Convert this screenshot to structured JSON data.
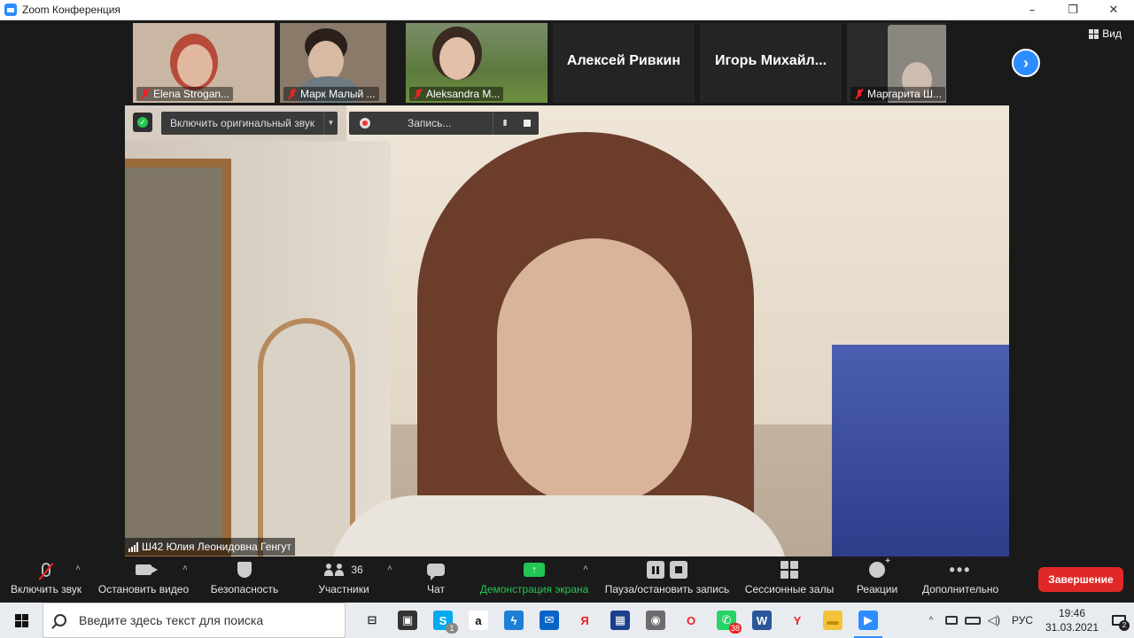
{
  "window": {
    "title": "Zoom Конференция",
    "minimize": "–",
    "maximize": "❐",
    "close": "✕"
  },
  "strip": {
    "thumbs": [
      {
        "name": "Elena Strogan..."
      },
      {
        "name": "Марк Малый ..."
      },
      {
        "name": "Aleksandra M..."
      },
      {
        "name": "",
        "big_name": "Алексей Ривкин"
      },
      {
        "name": "",
        "big_name": "Игорь  Михайл..."
      },
      {
        "name": "Маргарита Ш..."
      }
    ],
    "next": "›"
  },
  "view": {
    "label": "Вид"
  },
  "video_controls": {
    "original_audio": "Включить оригинальный звук",
    "recording": "Запись...",
    "pause_glyph": "II"
  },
  "speaker": {
    "name": "Ш42 Юлия Леонидовна Генгут"
  },
  "toolbar": {
    "unmute": "Включить звук",
    "stop_video": "Остановить видео",
    "security": "Безопасность",
    "participants": "Участники",
    "participants_count": "36",
    "chat": "Чат",
    "share": "Демонстрация экрана",
    "pause_record": "Пауза/остановить запись",
    "rooms": "Сессионные залы",
    "reactions": "Реакции",
    "more": "Дополнительно",
    "end": "Завершение",
    "caret": "˄",
    "share_glyph": "↑",
    "more_glyph": "•••"
  },
  "taskbar": {
    "search_placeholder": "Введите здесь текст для поиска",
    "apps": [
      {
        "icon": "task-view-icon",
        "letter": "⊟",
        "color": "#e8ecf1",
        "fg": "#222"
      },
      {
        "icon": "store-icon",
        "letter": "▣",
        "color": "#333333",
        "fg": "#fff"
      },
      {
        "icon": "skype-icon",
        "letter": "S",
        "color": "#00a9f0",
        "fg": "#fff",
        "badge": "1",
        "badge_gray": true
      },
      {
        "icon": "amazon-icon",
        "letter": "a",
        "color": "#ffffff",
        "fg": "#111"
      },
      {
        "icon": "bolt-icon",
        "letter": "ϟ",
        "color": "#1e7fd6",
        "fg": "#fff"
      },
      {
        "icon": "mail-icon",
        "letter": "✉",
        "color": "#0a64c8",
        "fg": "#fff"
      },
      {
        "icon": "yandex-icon",
        "letter": "Я",
        "color": "#e8ecf1",
        "fg": "#e22"
      },
      {
        "icon": "video-editor-icon",
        "letter": "▦",
        "color": "#1c3f8c",
        "fg": "#fff"
      },
      {
        "icon": "camera-icon",
        "letter": "◉",
        "color": "#6d6d6d",
        "fg": "#fff"
      },
      {
        "icon": "opera-icon",
        "letter": "O",
        "color": "#e8ecf1",
        "fg": "#e22"
      },
      {
        "icon": "whatsapp-icon",
        "letter": "✆",
        "color": "#25d366",
        "fg": "#fff",
        "badge": "38"
      },
      {
        "icon": "word-icon",
        "letter": "W",
        "color": "#2b579a",
        "fg": "#fff"
      },
      {
        "icon": "yandex-browser-icon",
        "letter": "Y",
        "color": "#e8ecf1",
        "fg": "#e22"
      },
      {
        "icon": "folder-icon",
        "letter": "▬",
        "color": "#f3c43b",
        "fg": "#c58b00"
      },
      {
        "icon": "zoom-icon",
        "letter": "▶",
        "color": "#2d8cff",
        "fg": "#fff",
        "active": true
      }
    ],
    "tray_expand": "^",
    "language": "РУС",
    "time": "19:46",
    "date": "31.03.2021",
    "notifications": "2"
  }
}
